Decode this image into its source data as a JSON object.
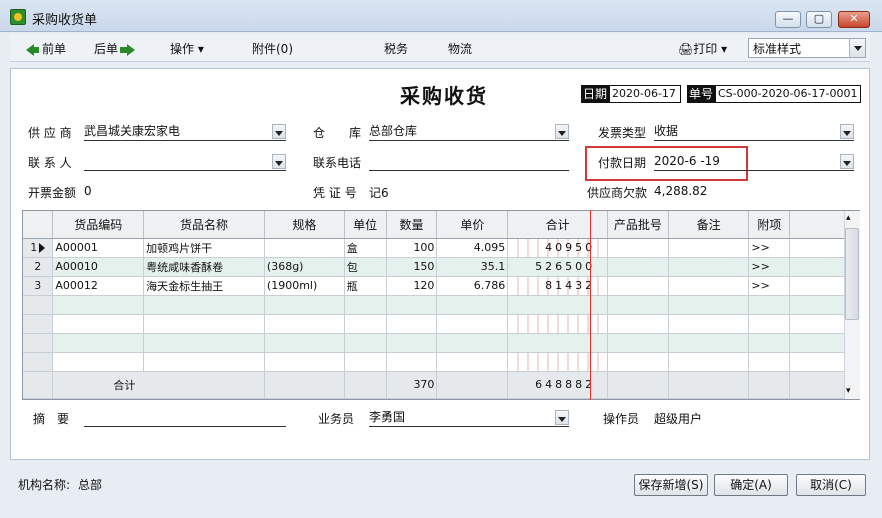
{
  "window": {
    "title": "采购收货单"
  },
  "toolbar": {
    "prev_label": "前单",
    "next_label": "后单",
    "ops_label": "操作",
    "attach_label": "附件(0)",
    "tax_label": "税务",
    "logistics_label": "物流",
    "print_label": "打印",
    "style_value": "标准样式"
  },
  "doc": {
    "title": "采购收货",
    "date_label": "日期",
    "date_value": "2020-06-17",
    "no_label": "单号",
    "no_value": "CS-000-2020-06-17-0001"
  },
  "fields": {
    "supplier_label": "供 应 商",
    "supplier_value": "武昌城关康宏家电",
    "warehouse_label": "仓　　库",
    "warehouse_value": "总部仓库",
    "invoice_type_label": "发票类型",
    "invoice_type_value": "收据",
    "contact_label": "联 系 人",
    "contact_value": "",
    "phone_label": "联系电话",
    "phone_value": "",
    "pay_date_label": "付款日期",
    "pay_date_value": "2020-6 -19",
    "invoice_amount_label": "开票金额",
    "invoice_amount_value": "0",
    "voucher_label": "凭 证 号",
    "voucher_value": "记6",
    "supplier_debt_label": "供应商欠款",
    "supplier_debt_value": "4,288.82"
  },
  "grid": {
    "headers": [
      "货品编码",
      "货品名称",
      "规格",
      "单位",
      "数量",
      "单价",
      "合计",
      "产品批号",
      "备注",
      "附项"
    ],
    "rows": [
      {
        "num": "1",
        "code": "A00001",
        "name": "加顿鸡片饼干",
        "spec": "",
        "unit": "盒",
        "qty": "100",
        "price": "4.095",
        "total": "40950",
        "batch": "",
        "note": "",
        "extra": ">>"
      },
      {
        "num": "2",
        "code": "A00010",
        "name": "粤统咸味香酥卷",
        "spec": "(368g)",
        "unit": "包",
        "qty": "150",
        "price": "35.1",
        "total": "526500",
        "batch": "",
        "note": "",
        "extra": ">>"
      },
      {
        "num": "3",
        "code": "A00012",
        "name": "海天金标生抽王",
        "spec": "(1900ml)",
        "unit": "瓶",
        "qty": "120",
        "price": "6.786",
        "total": "81432",
        "batch": "",
        "note": "",
        "extra": ">>"
      }
    ],
    "total_label": "合计",
    "total_qty": "370",
    "total_amount": "648882"
  },
  "bottom": {
    "summary_label": "摘　要",
    "summary_value": "",
    "salesman_label": "业务员",
    "salesman_value": "李勇国",
    "operator_label": "操作员",
    "operator_value": "超级用户"
  },
  "status": {
    "org_label": "机构名称:",
    "org_value": "总部",
    "save_new_label": "保存新增(S)",
    "ok_label": "确定(A)",
    "cancel_label": "取消(C)"
  },
  "colors": {
    "accent": "#2a8a2a",
    "highlight_box": "#d23a3a",
    "amount_red_line": "#e03030",
    "alt_row": "#e5f1ec"
  }
}
